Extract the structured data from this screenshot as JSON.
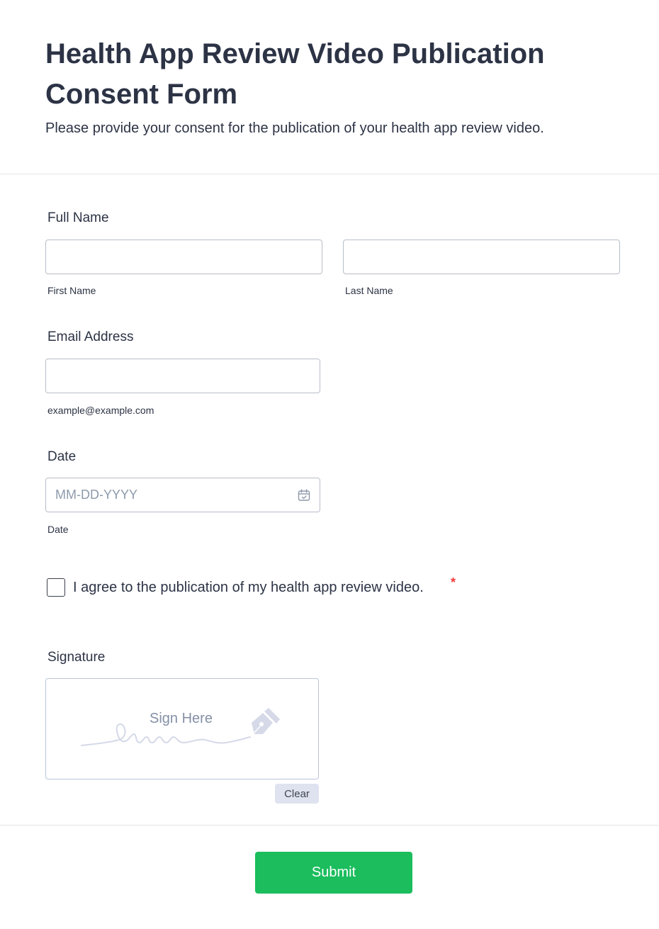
{
  "header": {
    "title": "Health App Review Video Publication Consent Form",
    "subtitle": "Please provide your consent for the publication of your health app review video."
  },
  "full_name": {
    "label": "Full Name",
    "first_value": "",
    "first_sublabel": "First Name",
    "last_value": "",
    "last_sublabel": "Last Name"
  },
  "email": {
    "label": "Email Address",
    "value": "",
    "sublabel": "example@example.com"
  },
  "date": {
    "label": "Date",
    "placeholder": "MM-DD-YYYY",
    "sublabel": "Date",
    "icon": "calendar-icon"
  },
  "consent": {
    "label": "I agree to the publication of my health app review video.",
    "required_mark": "*",
    "checked": false
  },
  "signature": {
    "label": "Signature",
    "placeholder": "Sign Here",
    "clear_label": "Clear",
    "icon": "pen-nib-icon"
  },
  "submit": {
    "label": "Submit"
  },
  "colors": {
    "submit_bg": "#1bbd5d",
    "required": "#f23a3c",
    "text": "#2c3345"
  }
}
